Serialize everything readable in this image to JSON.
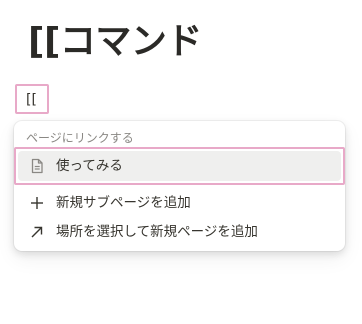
{
  "page": {
    "title": "[[コマンド"
  },
  "editor": {
    "input_text": "[["
  },
  "link_menu": {
    "section_label": "ページにリンクする",
    "items": [
      {
        "label": "使ってみる",
        "icon": "page-icon",
        "selected": true
      },
      {
        "label": "新規サブページを追加",
        "icon": "plus-icon",
        "selected": false
      },
      {
        "label": "場所を選択して新規ページを追加",
        "icon": "arrow-up-right-icon",
        "selected": false
      }
    ]
  },
  "colors": {
    "highlight_border": "#e8a9c8",
    "selected_bg": "#efefee",
    "text": "#37352f",
    "muted_text": "#8a8884"
  }
}
